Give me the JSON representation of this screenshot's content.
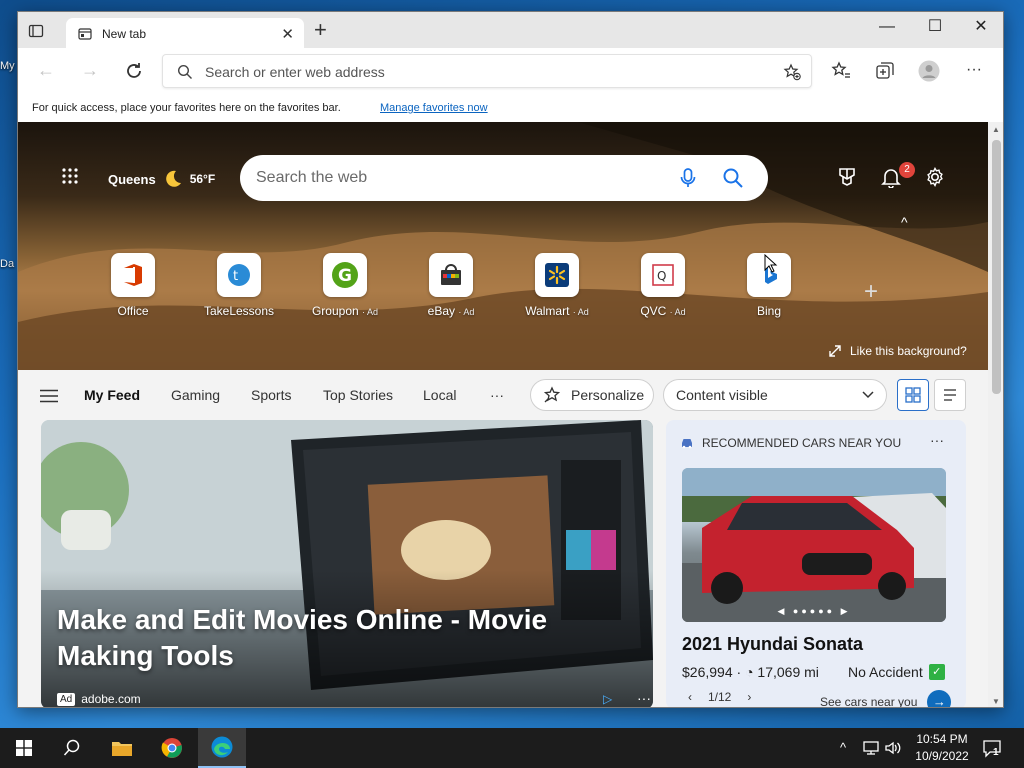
{
  "desktop": {
    "label_top": "My",
    "label_bottom": "Da"
  },
  "browser": {
    "tab_title": "New tab",
    "tab_close": "✕",
    "new_tab": "+",
    "win_min": "—",
    "win_max": "☐",
    "win_close": "✕",
    "address_placeholder": "Search or enter web address",
    "favorites_bar_text": "For quick access, place your favorites here on the favorites bar.",
    "favorites_bar_link": "Manage favorites now",
    "more_label": "···"
  },
  "hero": {
    "weather_location": "Queens",
    "weather_temp": "56°F",
    "search_placeholder": "Search the web",
    "notification_count": "2",
    "collapse_glyph": "^",
    "like_background": "Like this background?",
    "add_site": "+",
    "quick_links": [
      {
        "label": "Office",
        "ad": "",
        "color": "#d83b01",
        "glyph": "O"
      },
      {
        "label": "TakeLessons",
        "ad": "",
        "color": "#2a8bd6",
        "glyph": "t"
      },
      {
        "label": "Groupon",
        "ad": "· Ad",
        "color": "#53a318",
        "glyph": "G"
      },
      {
        "label": "eBay",
        "ad": "· Ad",
        "color": "#e53238",
        "glyph": "e"
      },
      {
        "label": "Walmart",
        "ad": "· Ad",
        "color": "#0071ce",
        "glyph": "W"
      },
      {
        "label": "QVC",
        "ad": "· Ad",
        "color": "#d03c4b",
        "glyph": "Q"
      },
      {
        "label": "Bing",
        "ad": "",
        "color": "#1b76d2",
        "glyph": "b"
      }
    ]
  },
  "feed_nav": {
    "tabs": [
      "My Feed",
      "Gaming",
      "Sports",
      "Top Stories",
      "Local"
    ],
    "more": "···",
    "personalize": "Personalize",
    "content_visible": "Content visible"
  },
  "main_card": {
    "title": "Make and Edit Movies Online - Movie Making Tools",
    "ad_label": "Ad",
    "source": "adobe.com",
    "more": "···"
  },
  "side_card": {
    "header": "RECOMMENDED CARS NEAR YOU",
    "more": "···",
    "car_title": "2021 Hyundai Sonata",
    "price": "$26,994",
    "mileage": "17,069 mi",
    "accident": "No Accident",
    "pager": "1/12",
    "see_cars": "See cars near you"
  },
  "taskbar": {
    "time": "10:54 PM",
    "date": "10/9/2022",
    "notif_count": "1"
  }
}
